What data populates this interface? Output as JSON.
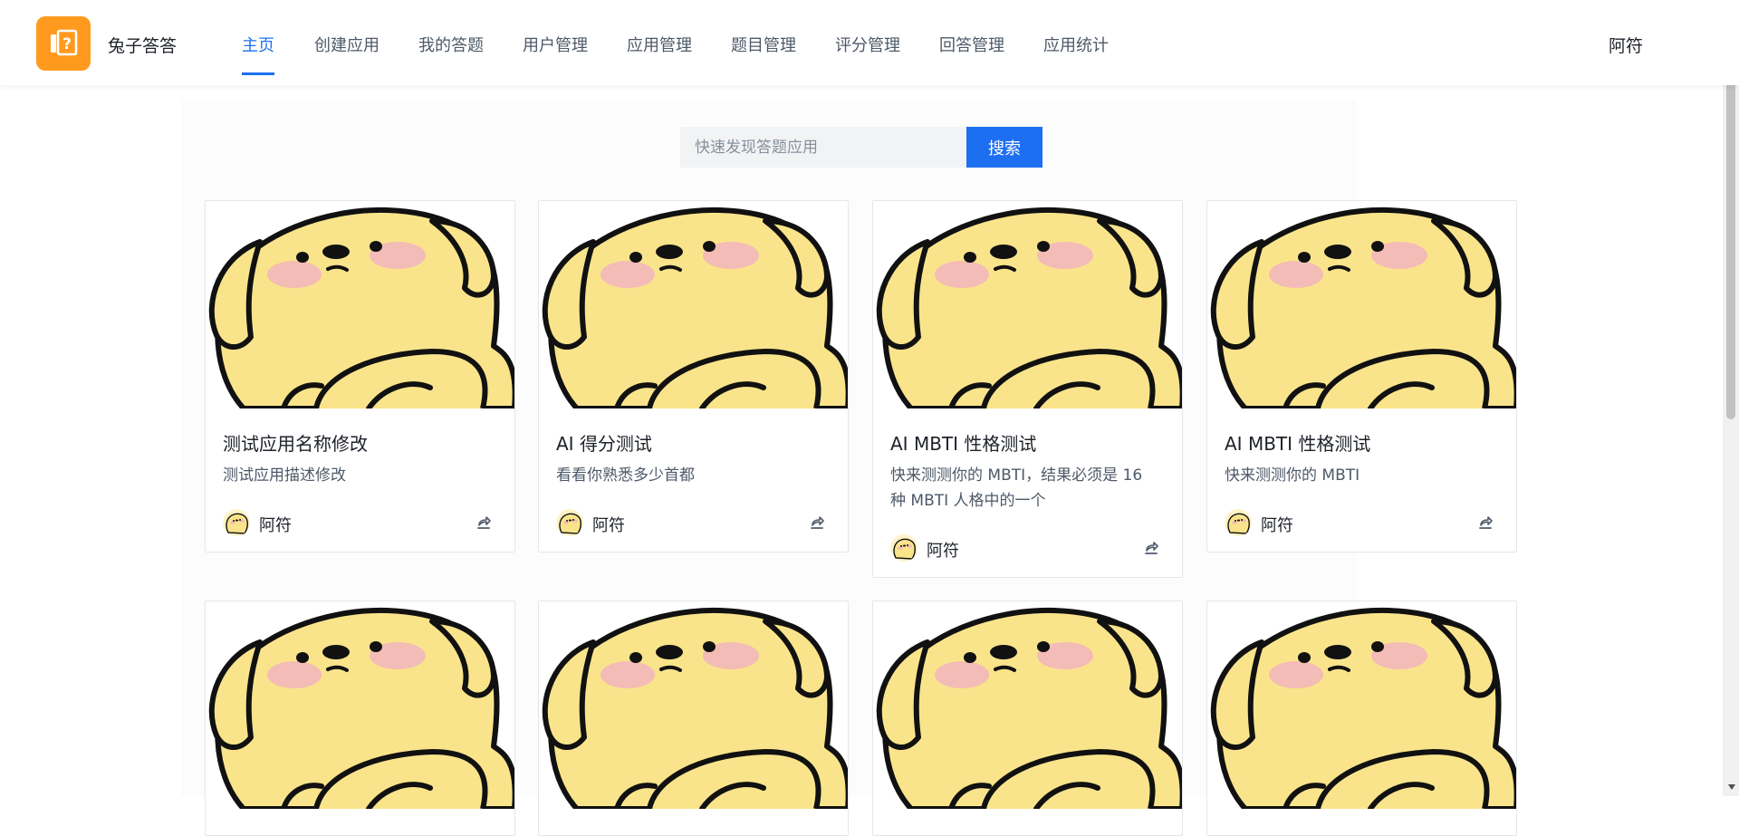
{
  "header": {
    "brand": "兔子答答",
    "nav": [
      {
        "label": "主页",
        "active": true
      },
      {
        "label": "创建应用",
        "active": false
      },
      {
        "label": "我的答题",
        "active": false
      },
      {
        "label": "用户管理",
        "active": false
      },
      {
        "label": "应用管理",
        "active": false
      },
      {
        "label": "题目管理",
        "active": false
      },
      {
        "label": "评分管理",
        "active": false
      },
      {
        "label": "回答管理",
        "active": false
      },
      {
        "label": "应用统计",
        "active": false
      }
    ],
    "user_name": "阿符"
  },
  "search": {
    "placeholder": "快速发现答题应用",
    "value": "",
    "button_label": "搜索"
  },
  "cards": [
    {
      "title": "测试应用名称修改",
      "description": "测试应用描述修改",
      "author": "阿符"
    },
    {
      "title": "AI 得分测试",
      "description": "看看你熟悉多少首都",
      "author": "阿符"
    },
    {
      "title": "AI MBTI 性格测试",
      "description": "快来测测你的 MBTI，结果必须是 16 种 MBTI 人格中的一个",
      "author": "阿符"
    },
    {
      "title": "AI MBTI 性格测试",
      "description": "快来测测你的 MBTI",
      "author": "阿符"
    },
    {
      "title": "",
      "description": "",
      "author": ""
    },
    {
      "title": "",
      "description": "",
      "author": ""
    },
    {
      "title": "",
      "description": "",
      "author": ""
    },
    {
      "title": "",
      "description": "",
      "author": ""
    }
  ],
  "colors": {
    "accent": "#1d6ff2",
    "logo_bg": "#ff9a1f",
    "mascot_fill": "#fae48b",
    "blush": "#f3bcb6"
  },
  "icons": {
    "logo": "question-book-icon",
    "share": "share-icon",
    "card_cover": "yellow-puppy-mascot"
  }
}
